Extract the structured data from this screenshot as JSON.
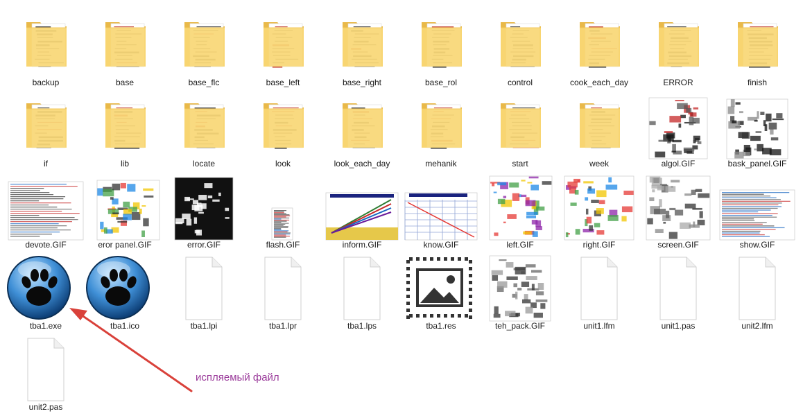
{
  "files": [
    {
      "name": "backup",
      "type": "folder",
      "icon": "folder-icon",
      "slug": "backup"
    },
    {
      "name": "base",
      "type": "folder",
      "icon": "folder-icon",
      "slug": "base"
    },
    {
      "name": "base_flc",
      "type": "folder",
      "icon": "folder-icon",
      "slug": "base-flc"
    },
    {
      "name": "base_left",
      "type": "folder",
      "icon": "folder-icon",
      "slug": "base-left"
    },
    {
      "name": "base_right",
      "type": "folder",
      "icon": "folder-icon",
      "slug": "base-right"
    },
    {
      "name": "base_rol",
      "type": "folder",
      "icon": "folder-icon",
      "slug": "base-rol"
    },
    {
      "name": "control",
      "type": "folder",
      "icon": "folder-icon",
      "slug": "control"
    },
    {
      "name": "cook_each_day",
      "type": "folder",
      "icon": "folder-icon",
      "slug": "cook-each-day"
    },
    {
      "name": "ERROR",
      "type": "folder",
      "icon": "folder-icon",
      "slug": "error-folder"
    },
    {
      "name": "finish",
      "type": "folder",
      "icon": "folder-icon",
      "slug": "finish"
    },
    {
      "name": "if",
      "type": "folder",
      "icon": "folder-icon",
      "slug": "if"
    },
    {
      "name": "lib",
      "type": "folder",
      "icon": "folder-icon",
      "slug": "lib"
    },
    {
      "name": "locate",
      "type": "folder",
      "icon": "folder-icon",
      "slug": "locate"
    },
    {
      "name": "look",
      "type": "folder",
      "icon": "folder-icon",
      "slug": "look"
    },
    {
      "name": "look_each_day",
      "type": "folder",
      "icon": "folder-icon",
      "slug": "look-each-day"
    },
    {
      "name": "mehanik",
      "type": "folder",
      "icon": "folder-icon",
      "slug": "mehanik"
    },
    {
      "name": "start",
      "type": "folder",
      "icon": "folder-icon",
      "slug": "start"
    },
    {
      "name": "week",
      "type": "folder",
      "icon": "folder-icon",
      "slug": "week"
    },
    {
      "name": "algol.GIF",
      "type": "image",
      "icon": "image-thumbnail-icon",
      "slug": "algol-gif"
    },
    {
      "name": "bask_panel.GIF",
      "type": "image",
      "icon": "image-thumbnail-icon",
      "slug": "bask-panel-gif"
    },
    {
      "name": "devote.GIF",
      "type": "image",
      "icon": "image-thumbnail-icon",
      "slug": "devote-gif"
    },
    {
      "name": "eror panel.GIF",
      "type": "image",
      "icon": "image-thumbnail-icon",
      "slug": "eror-panel-gif"
    },
    {
      "name": "error.GIF",
      "type": "image",
      "icon": "image-thumbnail-icon",
      "slug": "error-gif"
    },
    {
      "name": "flash.GIF",
      "type": "image",
      "icon": "image-thumbnail-icon",
      "slug": "flash-gif"
    },
    {
      "name": "inform.GIF",
      "type": "image",
      "icon": "image-thumbnail-icon",
      "slug": "inform-gif"
    },
    {
      "name": "know.GIF",
      "type": "image",
      "icon": "image-thumbnail-icon",
      "slug": "know-gif"
    },
    {
      "name": "left.GIF",
      "type": "image",
      "icon": "image-thumbnail-icon",
      "slug": "left-gif"
    },
    {
      "name": "right.GIF",
      "type": "image",
      "icon": "image-thumbnail-icon",
      "slug": "right-gif"
    },
    {
      "name": "screen.GIF",
      "type": "image",
      "icon": "image-thumbnail-icon",
      "slug": "screen-gif"
    },
    {
      "name": "show.GIF",
      "type": "image",
      "icon": "image-thumbnail-icon",
      "slug": "show-gif"
    },
    {
      "name": "tba1.exe",
      "type": "paw",
      "icon": "paw-app-icon",
      "slug": "tba1-exe"
    },
    {
      "name": "tba1.ico",
      "type": "paw",
      "icon": "paw-app-icon",
      "slug": "tba1-ico"
    },
    {
      "name": "tba1.lpi",
      "type": "document",
      "icon": "blank-file-icon",
      "slug": "tba1-lpi"
    },
    {
      "name": "tba1.lpr",
      "type": "document",
      "icon": "blank-file-icon",
      "slug": "tba1-lpr"
    },
    {
      "name": "tba1.lps",
      "type": "document",
      "icon": "blank-file-icon",
      "slug": "tba1-lps"
    },
    {
      "name": "tba1.res",
      "type": "resource",
      "icon": "image-file-icon",
      "slug": "tba1-res"
    },
    {
      "name": "teh_pack.GIF",
      "type": "image",
      "icon": "image-thumbnail-icon",
      "slug": "teh-pack-gif"
    },
    {
      "name": "unit1.lfm",
      "type": "document",
      "icon": "blank-file-icon",
      "slug": "unit1-lfm"
    },
    {
      "name": "unit1.pas",
      "type": "document",
      "icon": "blank-file-icon",
      "slug": "unit1-pas"
    },
    {
      "name": "unit2.lfm",
      "type": "document",
      "icon": "blank-file-icon",
      "slug": "unit2-lfm"
    },
    {
      "name": "unit2.pas",
      "type": "document",
      "icon": "blank-file-icon",
      "slug": "unit2-pas"
    }
  ],
  "annotation": {
    "text": "испляемый файл",
    "color": "#9a3a9a",
    "arrow_color": "#d9413a"
  },
  "colors": {
    "folder_back": "#e9b949",
    "folder_front": "#f8d775",
    "page_bg": "#ffffff"
  }
}
